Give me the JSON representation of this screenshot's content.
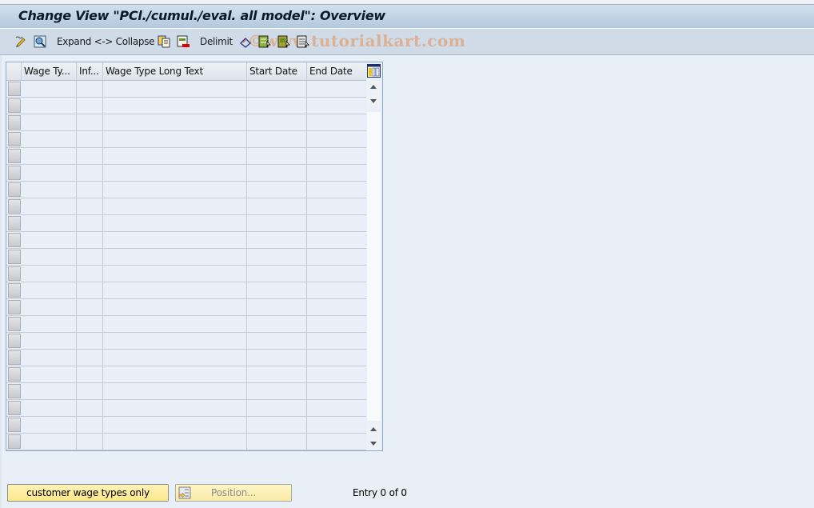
{
  "window": {
    "title": "Change View \"PCl./cumul./eval. all model\": Overview"
  },
  "toolbar": {
    "items": [
      {
        "type": "icon",
        "icon": "display-change-icon"
      },
      {
        "type": "icon",
        "icon": "find-icon"
      },
      {
        "type": "text",
        "label": "Expand <-> Collapse"
      },
      {
        "type": "icon",
        "icon": "copy-as-icon"
      },
      {
        "type": "icon",
        "icon": "delete-icon"
      },
      {
        "type": "text",
        "label": "Delimit"
      },
      {
        "type": "icon",
        "icon": "undo-change-icon"
      },
      {
        "type": "icon",
        "icon": "select-all-icon"
      },
      {
        "type": "icon",
        "icon": "select-block-icon"
      },
      {
        "type": "icon",
        "icon": "deselect-all-icon"
      }
    ],
    "expand_collapse_label": "Expand <-> Collapse",
    "delimit_label": "Delimit",
    "watermark": "©www.tutorialkart.com"
  },
  "table": {
    "columns": [
      {
        "key": "wage_type",
        "label": "Wage Ty..."
      },
      {
        "key": "inf",
        "label": "Inf..."
      },
      {
        "key": "long_text",
        "label": "Wage Type Long Text"
      },
      {
        "key": "start_date",
        "label": "Start Date"
      },
      {
        "key": "end_date",
        "label": "End Date"
      }
    ],
    "rows": [],
    "visible_empty_rows": 22,
    "column_config_icon": "table-settings-icon"
  },
  "footer": {
    "customer_button_label": "customer wage types only",
    "position_button_label": "Position...",
    "entry_text": "Entry 0 of 0"
  }
}
